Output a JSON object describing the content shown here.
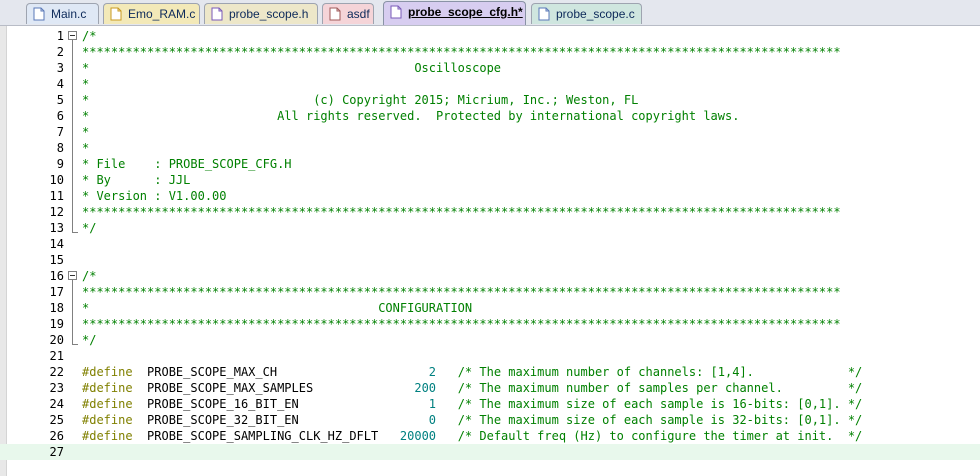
{
  "tabs": [
    {
      "label": "Main.c",
      "icon": "c-file-icon",
      "color": "#dfe8f5",
      "active": false
    },
    {
      "label": "Emo_RAM.c",
      "icon": "gear-file-icon",
      "color": "#f3e9b8",
      "active": false
    },
    {
      "label": "probe_scope.h",
      "icon": "h-file-icon",
      "color": "#ede7c9",
      "active": false
    },
    {
      "label": "asdf",
      "icon": "file-icon",
      "color": "#f5d4d8",
      "active": false
    },
    {
      "label": "probe_scope_cfg.h*",
      "icon": "h-file-icon",
      "color": "#d7cdf0",
      "active": true
    },
    {
      "label": "probe_scope.c",
      "icon": "c-file-icon",
      "color": "#cfe6df",
      "active": false
    }
  ],
  "lines": [
    {
      "n": "1",
      "t": "/*"
    },
    {
      "n": "2",
      "t": "*********************************************************************************************************"
    },
    {
      "n": "3",
      "t": "*                                             Oscilloscope"
    },
    {
      "n": "4",
      "t": "*"
    },
    {
      "n": "5",
      "t": "*                               (c) Copyright 2015; Micrium, Inc.; Weston, FL"
    },
    {
      "n": "6",
      "t": "*                          All rights reserved.  Protected by international copyright laws."
    },
    {
      "n": "7",
      "t": "*"
    },
    {
      "n": "8",
      "t": "*"
    },
    {
      "n": "9",
      "t": "* File    : PROBE_SCOPE_CFG.H"
    },
    {
      "n": "10",
      "t": "* By      : JJL"
    },
    {
      "n": "11",
      "t": "* Version : V1.00.00"
    },
    {
      "n": "12",
      "t": "*********************************************************************************************************"
    },
    {
      "n": "13",
      "t": "*/"
    },
    {
      "n": "14",
      "t": ""
    },
    {
      "n": "15",
      "t": ""
    },
    {
      "n": "16",
      "t": "/*"
    },
    {
      "n": "17",
      "t": "*********************************************************************************************************"
    },
    {
      "n": "18",
      "t": "*                                        CONFIGURATION"
    },
    {
      "n": "19",
      "t": "*********************************************************************************************************"
    },
    {
      "n": "20",
      "t": "*/"
    },
    {
      "n": "21",
      "t": ""
    },
    {
      "n": "22",
      "kw": "#define",
      "name": "PROBE_SCOPE_MAX_CH                 ",
      "val": "    2",
      "cm": "   /* The maximum number of channels: [1,4].             */"
    },
    {
      "n": "23",
      "kw": "#define",
      "name": "PROBE_SCOPE_MAX_SAMPLES            ",
      "val": "  200",
      "cm": "   /* The maximum number of samples per channel.         */"
    },
    {
      "n": "24",
      "kw": "#define",
      "name": "PROBE_SCOPE_16_BIT_EN              ",
      "val": "    1",
      "cm": "   /* The maximum size of each sample is 16-bits: [0,1]. */"
    },
    {
      "n": "25",
      "kw": "#define",
      "name": "PROBE_SCOPE_32_BIT_EN              ",
      "val": "    0",
      "cm": "   /* The maximum size of each sample is 32-bits: [0,1]. */"
    },
    {
      "n": "26",
      "kw": "#define",
      "name": "PROBE_SCOPE_SAMPLING_CLK_HZ_DFLT   ",
      "val": "20000",
      "cm": "   /* Default freq (Hz) to configure the timer at init.  */"
    },
    {
      "n": "27",
      "t": ""
    }
  ]
}
